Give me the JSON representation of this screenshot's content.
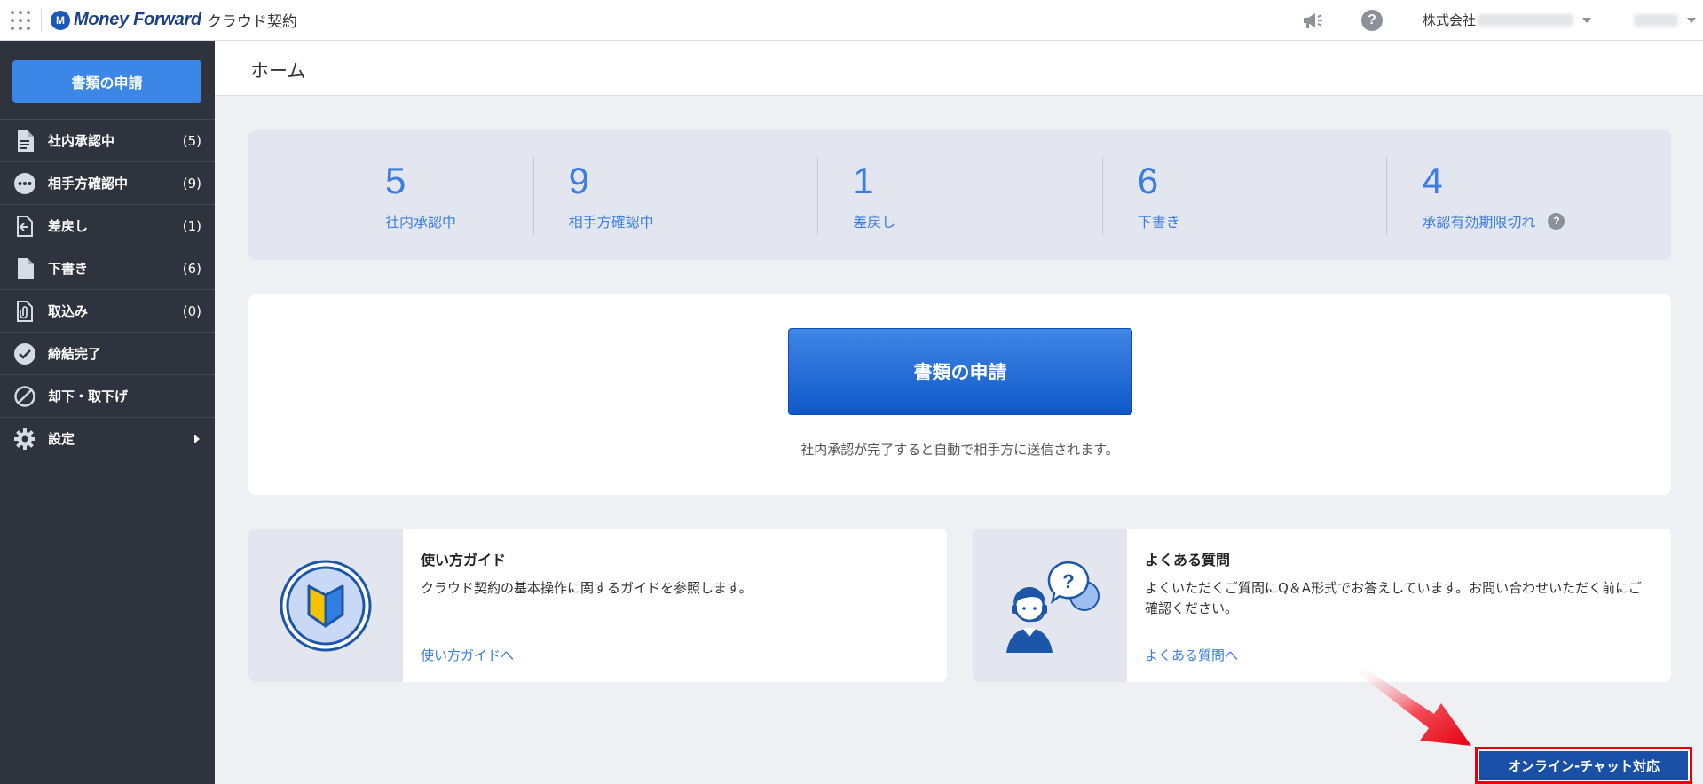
{
  "header": {
    "logo_mark": "M",
    "logo_text": "Money Forward",
    "product_name": "クラウド契約",
    "company_prefix": "株式会社",
    "icons": [
      "apps-icon",
      "announcement-icon",
      "help-icon"
    ],
    "help_glyph": "?"
  },
  "sidebar": {
    "apply_button": "書類の申請",
    "items": [
      {
        "label": "社内承認中",
        "count": "(5)",
        "icon": "document-icon"
      },
      {
        "label": "相手方確認中",
        "count": "(9)",
        "icon": "more-dots-icon"
      },
      {
        "label": "差戻し",
        "count": "(1)",
        "icon": "return-document-icon"
      },
      {
        "label": "下書き",
        "count": "(6)",
        "icon": "draft-file-icon"
      },
      {
        "label": "取込み",
        "count": "(0)",
        "icon": "import-clip-icon"
      },
      {
        "label": "締結完了",
        "count": "",
        "icon": "check-circle-icon"
      },
      {
        "label": "却下・取下げ",
        "count": "",
        "icon": "prohibited-icon"
      },
      {
        "label": "設定",
        "count": "",
        "icon": "gear-icon"
      }
    ]
  },
  "main": {
    "page_title": "ホーム",
    "stats": [
      {
        "num": "5",
        "label": "社内承認中"
      },
      {
        "num": "9",
        "label": "相手方確認中"
      },
      {
        "num": "1",
        "label": "差戻し"
      },
      {
        "num": "6",
        "label": "下書き"
      },
      {
        "num": "4",
        "label": "承認有効期限切れ"
      }
    ],
    "stats_help_glyph": "?",
    "apply_button": "書類の申請",
    "apply_note": "社内承認が完了すると自動で相手方に送信されます。",
    "guide": {
      "title": "使い方ガイド",
      "desc": "クラウド契約の基本操作に関するガイドを参照します。",
      "link": "使い方ガイドへ"
    },
    "faq": {
      "title": "よくある質問",
      "desc": "よくいただくご質問にQ＆A形式でお答えしています。お問い合わせいただく前にご確認ください。",
      "link": "よくある質問へ"
    },
    "chat_button": "オンライン-チャット対応"
  },
  "colors": {
    "sidebar_bg": "#2e333d",
    "accent_blue": "#3b7de0",
    "primary_button": "#1058c8",
    "chat_button": "#1a4fa8",
    "highlight_red": "#e60012"
  }
}
